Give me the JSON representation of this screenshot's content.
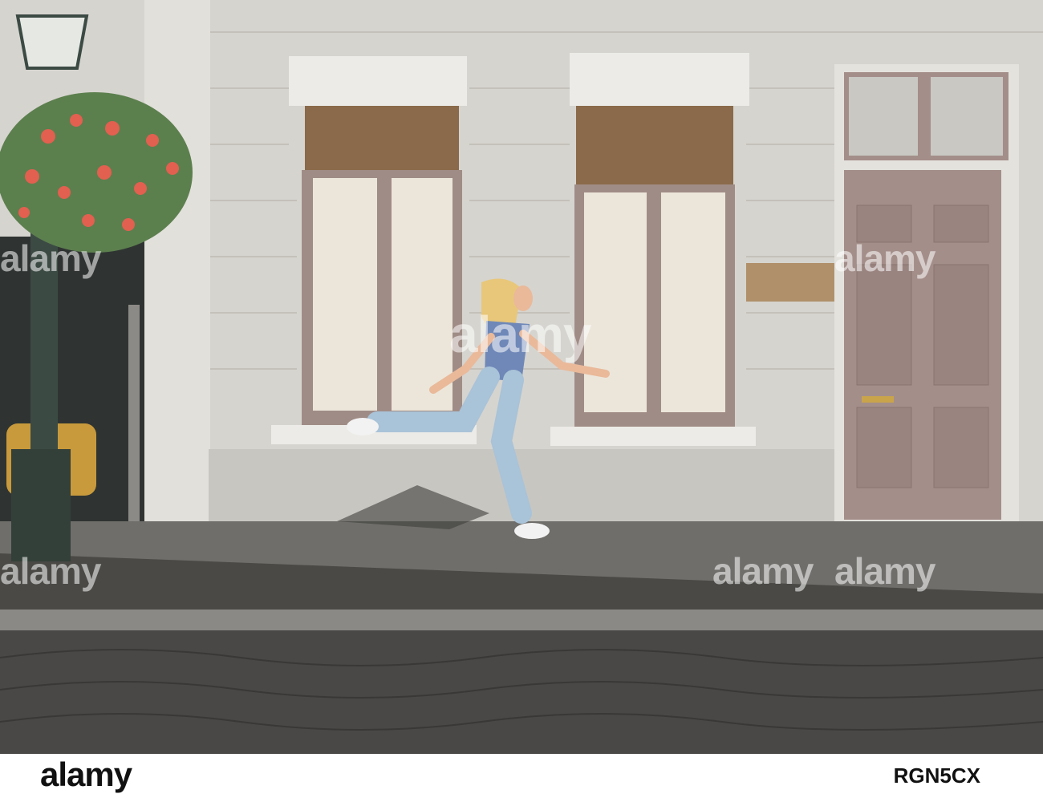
{
  "watermark": {
    "text": "alamy",
    "color": "#ffffff"
  },
  "footer": {
    "logo": "alamy",
    "image_id": "RGN5CX"
  },
  "scene": {
    "facade_color": "#d6d4cf",
    "sidewalk_color": "#6f6e6b",
    "cobblestone_color": "#4a4846",
    "door_color": "#a48e8a",
    "window_frame_color": "#a08c86",
    "shirt_color": "#6f88b8",
    "jeans_color": "#a9c3d8",
    "hair_color": "#e8c77a",
    "flowers_color": "#e1604f",
    "foliage_color": "#5c7f4e",
    "lamp_post_color": "#3c4a44"
  }
}
